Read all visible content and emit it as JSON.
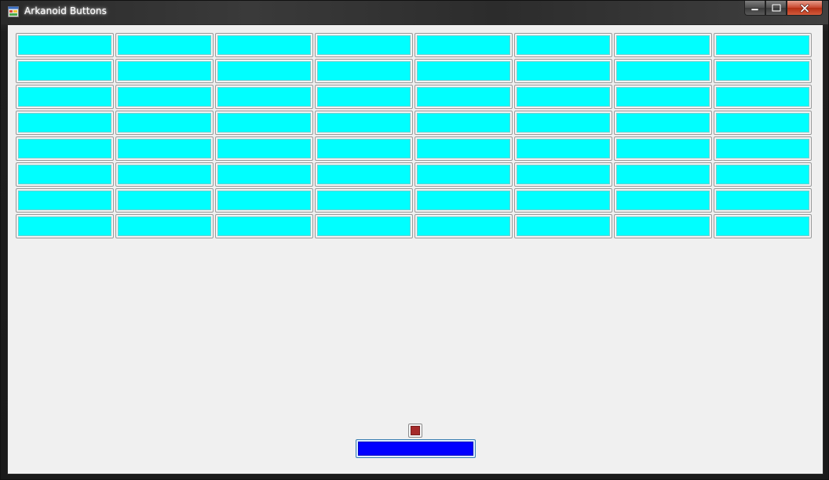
{
  "window": {
    "title": "Arkanoid Buttons",
    "icon": "winforms-app-icon",
    "caption_buttons": [
      "minimize-icon",
      "maximize-icon",
      "close-icon"
    ]
  },
  "game": {
    "bricks": {
      "rows": 8,
      "columns": 8,
      "color": "#00ffff"
    },
    "ball": {
      "color": "#a52a2a"
    },
    "paddle": {
      "color": "#0000ff",
      "focused": true
    }
  },
  "colors": {
    "client_background": "#f0f0f0",
    "brick": "#00ffff",
    "ball": "#a52a2a",
    "paddle": "#0000ff"
  }
}
